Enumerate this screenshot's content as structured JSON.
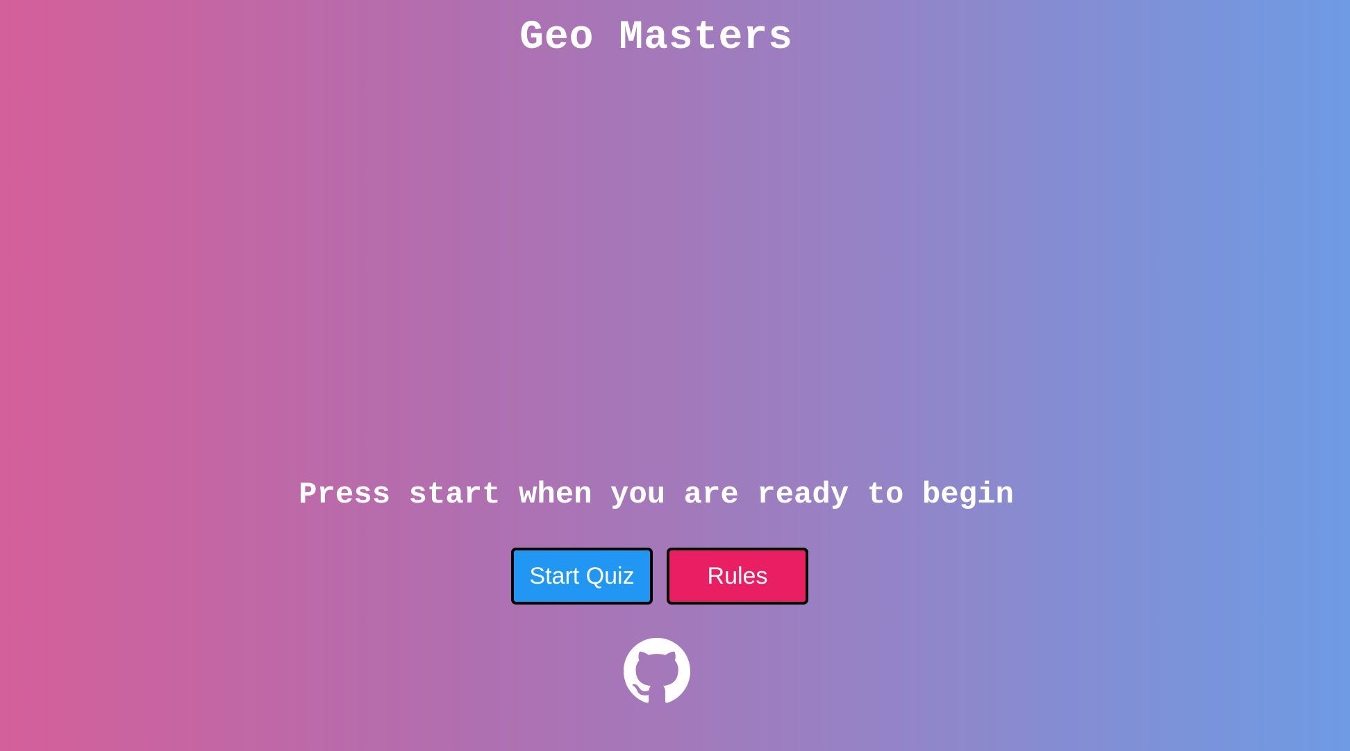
{
  "header": {
    "title": "Geo Masters"
  },
  "main": {
    "prompt": "Press start when you are ready to begin",
    "start_label": "Start Quiz",
    "rules_label": "Rules"
  },
  "footer": {
    "icon": "github-icon"
  },
  "colors": {
    "gradient_start": "#d45f9a",
    "gradient_end": "#6e9be4",
    "start_button": "#2196f3",
    "rules_button": "#e91e63"
  }
}
